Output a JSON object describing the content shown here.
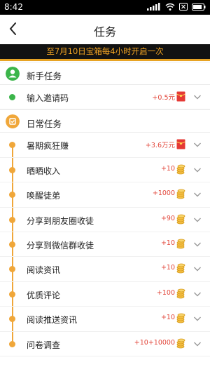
{
  "status_bar": {
    "time": "8:42"
  },
  "header": {
    "title": "任务"
  },
  "banner": {
    "text": "至7月10日宝箱每4小时开启一次"
  },
  "sections": [
    {
      "title": "新手任务",
      "color": "#3bb54a",
      "tasks": [
        {
          "name": "输入邀请码",
          "reward": "+0.5元",
          "reward_icon": "red-envelope-icon"
        }
      ]
    },
    {
      "title": "日常任务",
      "color": "#f0a73a",
      "tasks": [
        {
          "name": "暑期疯狂赚",
          "reward": "+3.6万元",
          "reward_icon": "red-envelope-icon"
        },
        {
          "name": "晒晒收入",
          "reward": "+10",
          "reward_icon": "coin-icon"
        },
        {
          "name": "唤醒徒弟",
          "reward": "+1000",
          "reward_icon": "coin-icon"
        },
        {
          "name": "分享到朋友圈收徒",
          "reward": "+90",
          "reward_icon": "coin-icon"
        },
        {
          "name": "分享到微信群收徒",
          "reward": "+10",
          "reward_icon": "coin-icon"
        },
        {
          "name": "阅读资讯",
          "reward": "+10",
          "reward_icon": "coin-icon"
        },
        {
          "name": "优质评论",
          "reward": "+100",
          "reward_icon": "coin-icon"
        },
        {
          "name": "阅读推送资讯",
          "reward": "+10",
          "reward_icon": "coin-icon"
        },
        {
          "name": "问卷调查",
          "reward": "+10+10000",
          "reward_icon": "coin-icon"
        }
      ]
    }
  ]
}
